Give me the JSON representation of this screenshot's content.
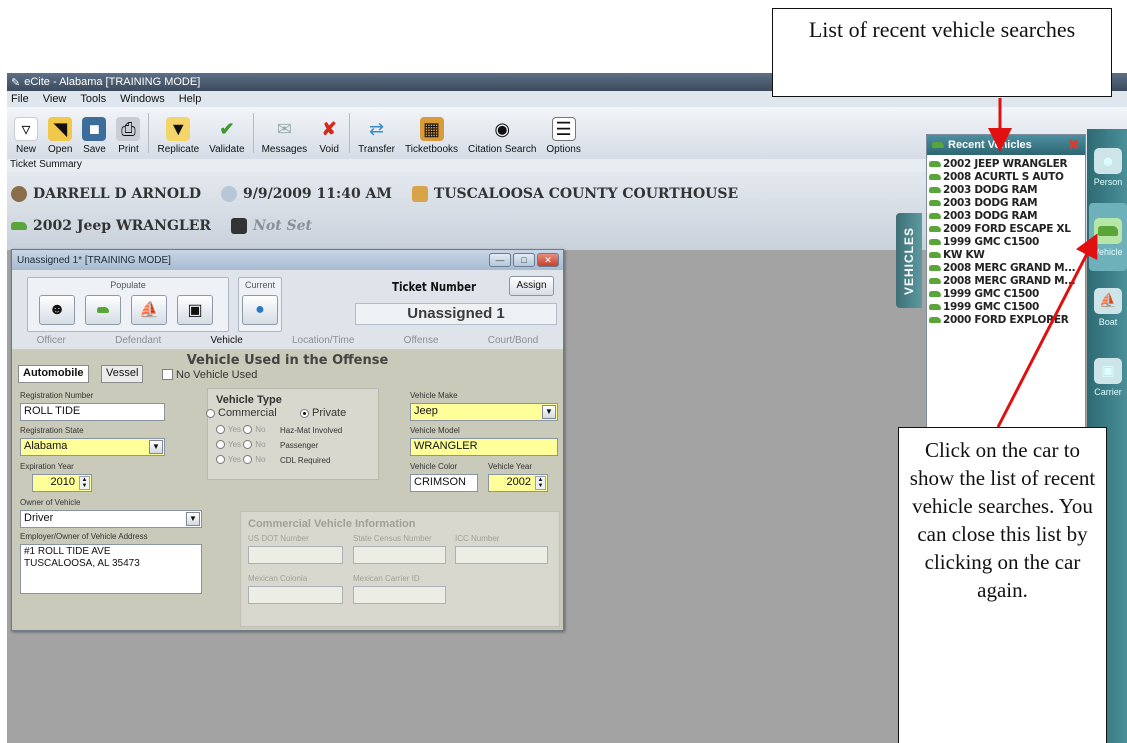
{
  "window": {
    "title": "eCite - Alabama [TRAINING MODE]"
  },
  "menu": [
    "File",
    "View",
    "Tools",
    "Windows",
    "Help"
  ],
  "toolbar": {
    "new": "New",
    "open": "Open",
    "save": "Save",
    "print": "Print",
    "replicate": "Replicate",
    "validate": "Validate",
    "messages": "Messages",
    "void": "Void",
    "transfer": "Transfer",
    "ticketbooks": "Ticketbooks",
    "citation_search": "Citation Search",
    "options": "Options"
  },
  "summary": {
    "label": "Ticket Summary",
    "officer": "DARRELL D ARNOLD",
    "datetime": "9/9/2009 11:40 AM",
    "location": "TUSCALOOSA COUNTY COURTHOUSE",
    "vehicle": "2002 Jeep WRANGLER",
    "citation": "Not Set"
  },
  "ticket": {
    "window_title": "Unassigned 1* [TRAINING MODE]",
    "populate_label": "Populate",
    "current_label": "Current",
    "ticket_number_label": "Ticket Number",
    "assign_label": "Assign",
    "ticket_number": "Unassigned 1",
    "steps": [
      "Officer",
      "Defendant",
      "Vehicle",
      "Location/Time",
      "Offense",
      "Court/Bond"
    ],
    "section_title": "Vehicle Used in the Offense",
    "tab_automobile": "Automobile",
    "tab_vessel": "Vessel",
    "no_vehicle_used": "No Vehicle Used",
    "registration_number_label": "Registration Number",
    "registration_number": "ROLL TIDE",
    "registration_state_label": "Registration State",
    "registration_state": "Alabama",
    "expiration_year_label": "Expiration Year",
    "expiration_year": "2010",
    "owner_label": "Owner of Vehicle",
    "owner": "Driver",
    "address_label": "Employer/Owner of Vehicle Address",
    "address_line1": "#1 ROLL TIDE AVE",
    "address_line2": "TUSCALOOSA, AL 35473",
    "vehicle_type_label": "Vehicle Type",
    "commercial": "Commercial",
    "private": "Private",
    "yes": "Yes",
    "no": "No",
    "hazmat": "Haz-Mat Involved",
    "passenger": "Passenger",
    "cdl": "CDL Required",
    "make_label": "Vehicle Make",
    "make": "Jeep",
    "model_label": "Vehicle Model",
    "model": "WRANGLER",
    "color_label": "Vehicle Color",
    "color": "CRIMSON",
    "year_label": "Vehicle Year",
    "year": "2002",
    "cvi_title": "Commercial Vehicle Information",
    "usdot_label": "US DOT Number",
    "state_census_label": "State Census Number",
    "icc_label": "ICC Number",
    "mexican_colonia_label": "Mexican Colonia",
    "mexican_carrier_label": "Mexican Carrier ID"
  },
  "vehicles_tab": "VEHICLES",
  "recent": {
    "title": "Recent Vehicles",
    "items": [
      "2002 JEEP WRANGLER",
      "2008 ACURTL S AUTO",
      "2003 DODG RAM",
      "2003 DODG RAM",
      "2003 DODG RAM",
      "2009 FORD ESCAPE XL",
      "1999 GMC C1500",
      "KW KW",
      "2008 MERC GRAND M...",
      "2008 MERC GRAND M...",
      "1999 GMC C1500",
      "1999 GMC C1500",
      "2000 FORD EXPLORER"
    ]
  },
  "sidebar": {
    "person": "Person",
    "vehicle": "Vehicle",
    "boat": "Boat",
    "carrier": "Carrier"
  },
  "callouts": {
    "top": "List of recent vehicle searches",
    "bottom": "Click on the car to show the list of recent vehicle searches. You can close this list by clicking on the car again."
  },
  "colors": {
    "required_field": "#ffff99",
    "panel_teal": "#2f6672",
    "arrow": "#e01010"
  }
}
